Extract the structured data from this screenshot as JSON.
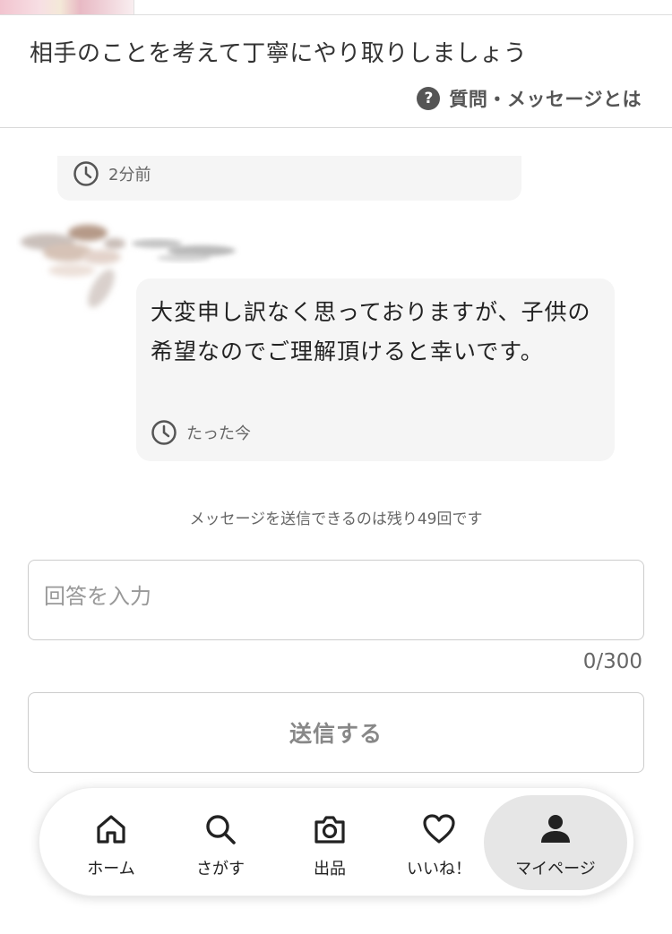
{
  "header": {
    "title": "相手のことを考えて丁寧にやり取りしましょう",
    "help_link": "質問・メッセージとは",
    "help_icon": "help-circle-icon"
  },
  "messages": [
    {
      "time": "2分前",
      "icon": "clock-icon"
    },
    {
      "text": "大変申し訳なく思っておりますが、子供の希望なのでご理解頂けると幸いです。",
      "time": "たった今",
      "icon": "clock-icon"
    }
  ],
  "composer": {
    "remaining_notice": "メッセージを送信できるのは残り49回です",
    "input_placeholder": "回答を入力",
    "input_value": "",
    "char_count": "0/300",
    "send_label": "送信する"
  },
  "nav": {
    "items": [
      {
        "label": "ホーム",
        "icon": "home-icon",
        "active": false
      },
      {
        "label": "さがす",
        "icon": "search-icon",
        "active": false
      },
      {
        "label": "出品",
        "icon": "camera-icon",
        "active": false
      },
      {
        "label": "いいね！",
        "icon": "heart-icon",
        "active": false
      },
      {
        "label": "マイページ",
        "icon": "person-icon",
        "active": true
      }
    ]
  },
  "colors": {
    "bubble_bg": "#f5f5f5",
    "nav_active_bg": "#e6e6e6",
    "text_primary": "#333333",
    "text_secondary": "#666666"
  }
}
